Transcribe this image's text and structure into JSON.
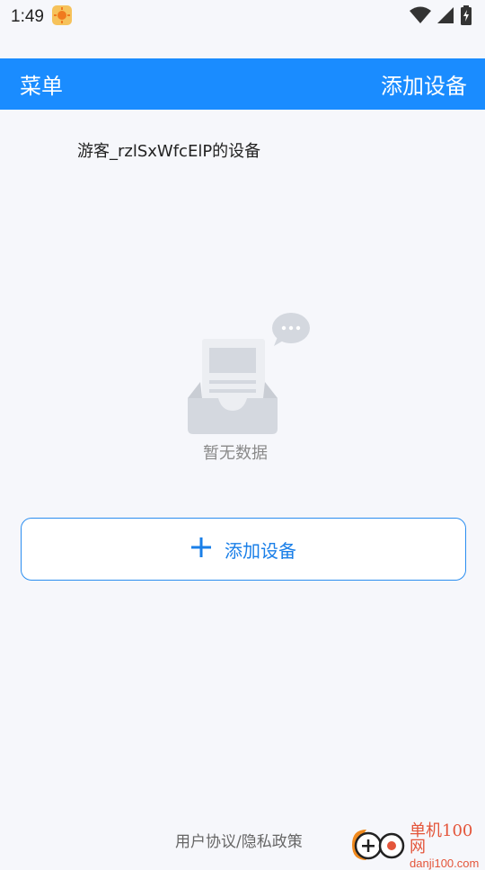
{
  "status_bar": {
    "time": "1:49"
  },
  "header": {
    "menu_label": "菜单",
    "add_label": "添加设备"
  },
  "device_list": {
    "title": "游客_rzlSxWfcElP的设备"
  },
  "empty_state": {
    "text": "暂无数据"
  },
  "add_button": {
    "label": "添加设备"
  },
  "footer": {
    "policy_link": "用户协议/隐私政策"
  },
  "watermark": {
    "main": "单机100网",
    "sub": "danji100.com"
  },
  "colors": {
    "accent": "#1a8cff",
    "button_border": "#2b8ef0",
    "background": "#f6f7fb"
  }
}
